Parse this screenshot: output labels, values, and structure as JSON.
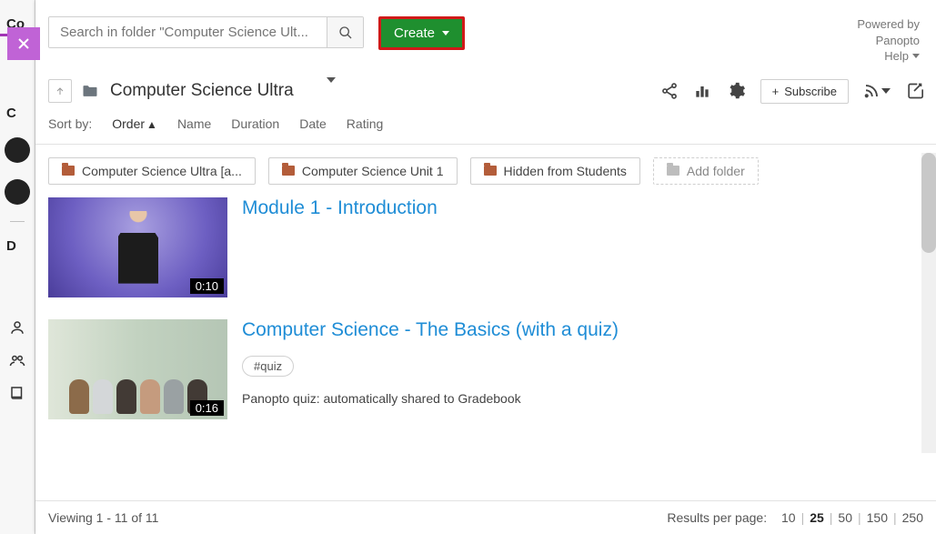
{
  "top": {
    "search_placeholder": "Search in folder \"Computer Science Ult...",
    "create_label": "Create",
    "powered_line1": "Powered by",
    "powered_line2": "Panopto",
    "help_label": "Help"
  },
  "crumb": {
    "folder_title": "Computer Science Ultra",
    "subscribe_label": "Subscribe"
  },
  "sort": {
    "prefix": "Sort by:",
    "options": [
      "Order",
      "Name",
      "Duration",
      "Date",
      "Rating"
    ],
    "selected": "Order",
    "direction": "asc"
  },
  "chips": [
    {
      "label": "Computer Science Ultra [a..."
    },
    {
      "label": "Computer Science Unit 1"
    },
    {
      "label": "Hidden from Students"
    }
  ],
  "add_folder_label": "Add folder",
  "items": [
    {
      "title": "Module 1 - Introduction",
      "duration": "0:10",
      "tags": [],
      "desc": ""
    },
    {
      "title": "Computer Science - The Basics (with a quiz)",
      "duration": "0:16",
      "tags": [
        "#quiz"
      ],
      "desc": "Panopto quiz: automatically shared to Gradebook"
    }
  ],
  "footer": {
    "viewing": "Viewing 1 - 11 of 11",
    "rpp_label": "Results per page:",
    "rpp_options": [
      "10",
      "25",
      "50",
      "150",
      "250"
    ],
    "rpp_selected": "25"
  },
  "peek": {
    "labels": [
      "Co",
      "C",
      "D"
    ]
  },
  "icons": {
    "close": "✕",
    "up": "↑",
    "plus": "+"
  }
}
